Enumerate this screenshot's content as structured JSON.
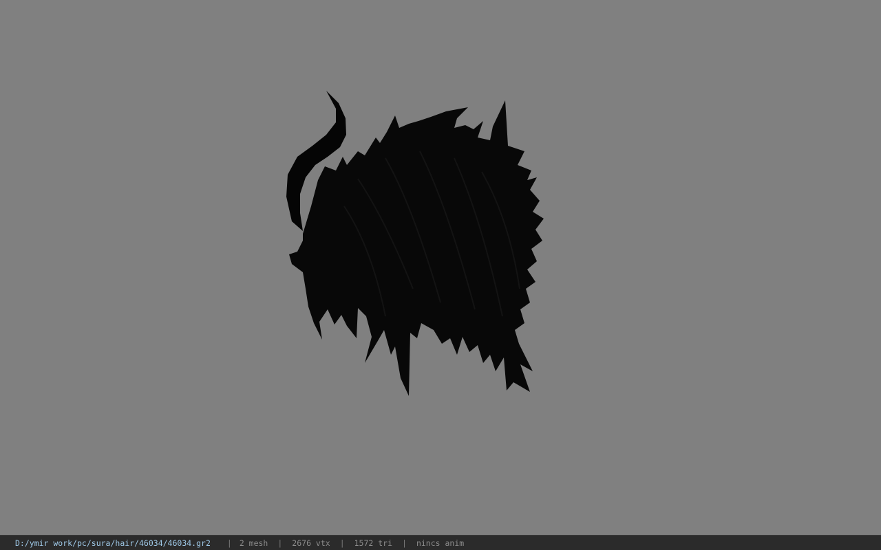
{
  "viewer": {
    "background_color": "#808080",
    "model_color": "#000000",
    "model_icon": "hair-mesh-silhouette"
  },
  "status_bar": {
    "file_path": "D:/ymir work/pc/sura/hair/46034/46034.gr2",
    "separator": "|",
    "mesh_count": "2 mesh",
    "vertex_count": "2676 vtx",
    "triangle_count": "1572 tri",
    "animation": "nincs anim"
  }
}
